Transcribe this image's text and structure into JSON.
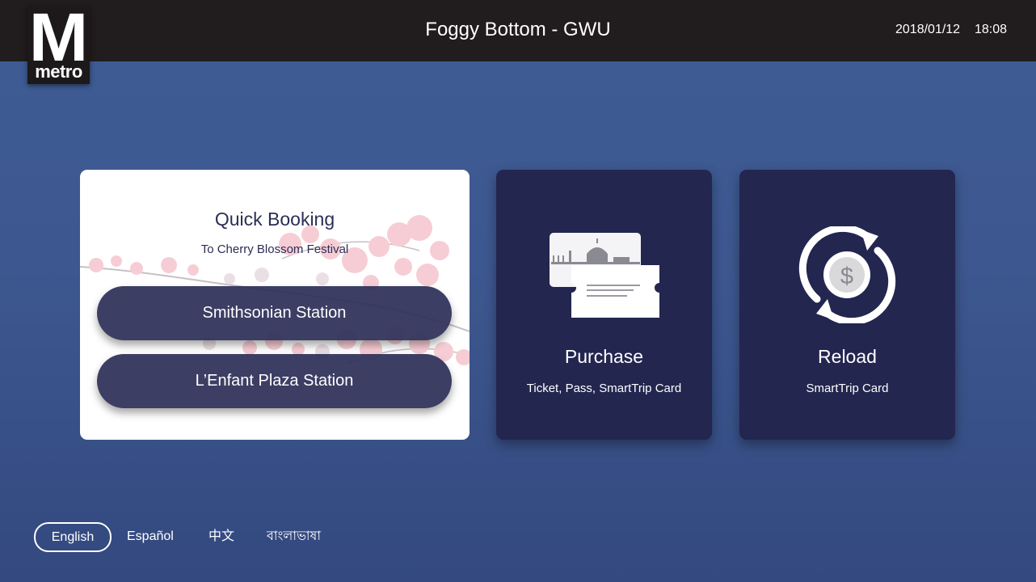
{
  "header": {
    "logo_letter": "M",
    "logo_word": "metro",
    "station": "Foggy Bottom - GWU",
    "date": "2018/01/12",
    "time": "18:08"
  },
  "quick_booking": {
    "title": "Quick Booking",
    "subtitle": "To Cherry Blossom Festival",
    "options": [
      {
        "label": "Smithsonian Station"
      },
      {
        "label": "L’Enfant Plaza Station"
      }
    ]
  },
  "purchase": {
    "title": "Purchase",
    "subtitle": "Ticket, Pass, SmartTrip Card",
    "icon": "ticket-icon"
  },
  "reload": {
    "title": "Reload",
    "subtitle": "SmartTrip Card",
    "icon": "reload-dollar-icon",
    "symbol": "$"
  },
  "languages": [
    {
      "label": "English",
      "selected": true
    },
    {
      "label": "Español",
      "selected": false
    },
    {
      "label": "中文",
      "selected": false
    },
    {
      "label": "বাংলাভাষা",
      "selected": false
    }
  ],
  "colors": {
    "background": "#3d5890",
    "header": "#211c1d",
    "card_dark": "#23264f",
    "pill": "#2d2f58",
    "accent_text": "#2b2e55"
  }
}
